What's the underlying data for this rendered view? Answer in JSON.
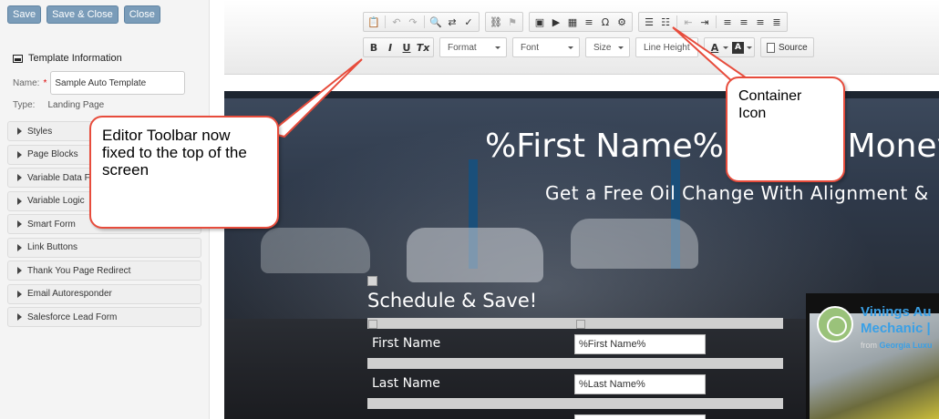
{
  "sidebar": {
    "buttons": {
      "save": "Save",
      "save_close": "Save & Close",
      "close": "Close"
    },
    "template_info": "Template Information",
    "name_label": "Name:",
    "name_required": "*",
    "name_value": "Sample Auto Template",
    "type_label": "Type:",
    "type_value": "Landing Page",
    "sections": [
      "Styles",
      "Page Blocks",
      "Variable Data F",
      "Variable Logic",
      "Smart Form",
      "Link Buttons",
      "Thank You Page Redirect",
      "Email Autoresponder",
      "Salesforce Lead Form"
    ]
  },
  "toolbar": {
    "format": "Format",
    "font": "Font",
    "size": "Size",
    "line_height": "Line Height",
    "source": "Source",
    "bold": "B",
    "italic": "I",
    "underline": "U",
    "clear_format": "Tx",
    "text_color": "A",
    "bg_color": "A",
    "omega": "Ω"
  },
  "hero": {
    "title": "%First Name% - Save Money O",
    "subtitle": "Get a Free Oil Change With Alignment &"
  },
  "form": {
    "heading": "Schedule & Save!",
    "fields": [
      {
        "label": "First Name",
        "value": "%First Name%"
      },
      {
        "label": "Last Name",
        "value": "%Last Name%"
      }
    ]
  },
  "video": {
    "title_line1": "Vinings Au",
    "title_line2": "Mechanic |",
    "from": "from",
    "source": "Georgia Luxu"
  },
  "callouts": {
    "toolbar": "Editor Toolbar now fixed to the top of the screen",
    "container": "Container Icon"
  },
  "colors": {
    "callout_border": "#e74c3c",
    "button_bg": "#7a9cb9",
    "video_title": "#3aa0e6"
  }
}
